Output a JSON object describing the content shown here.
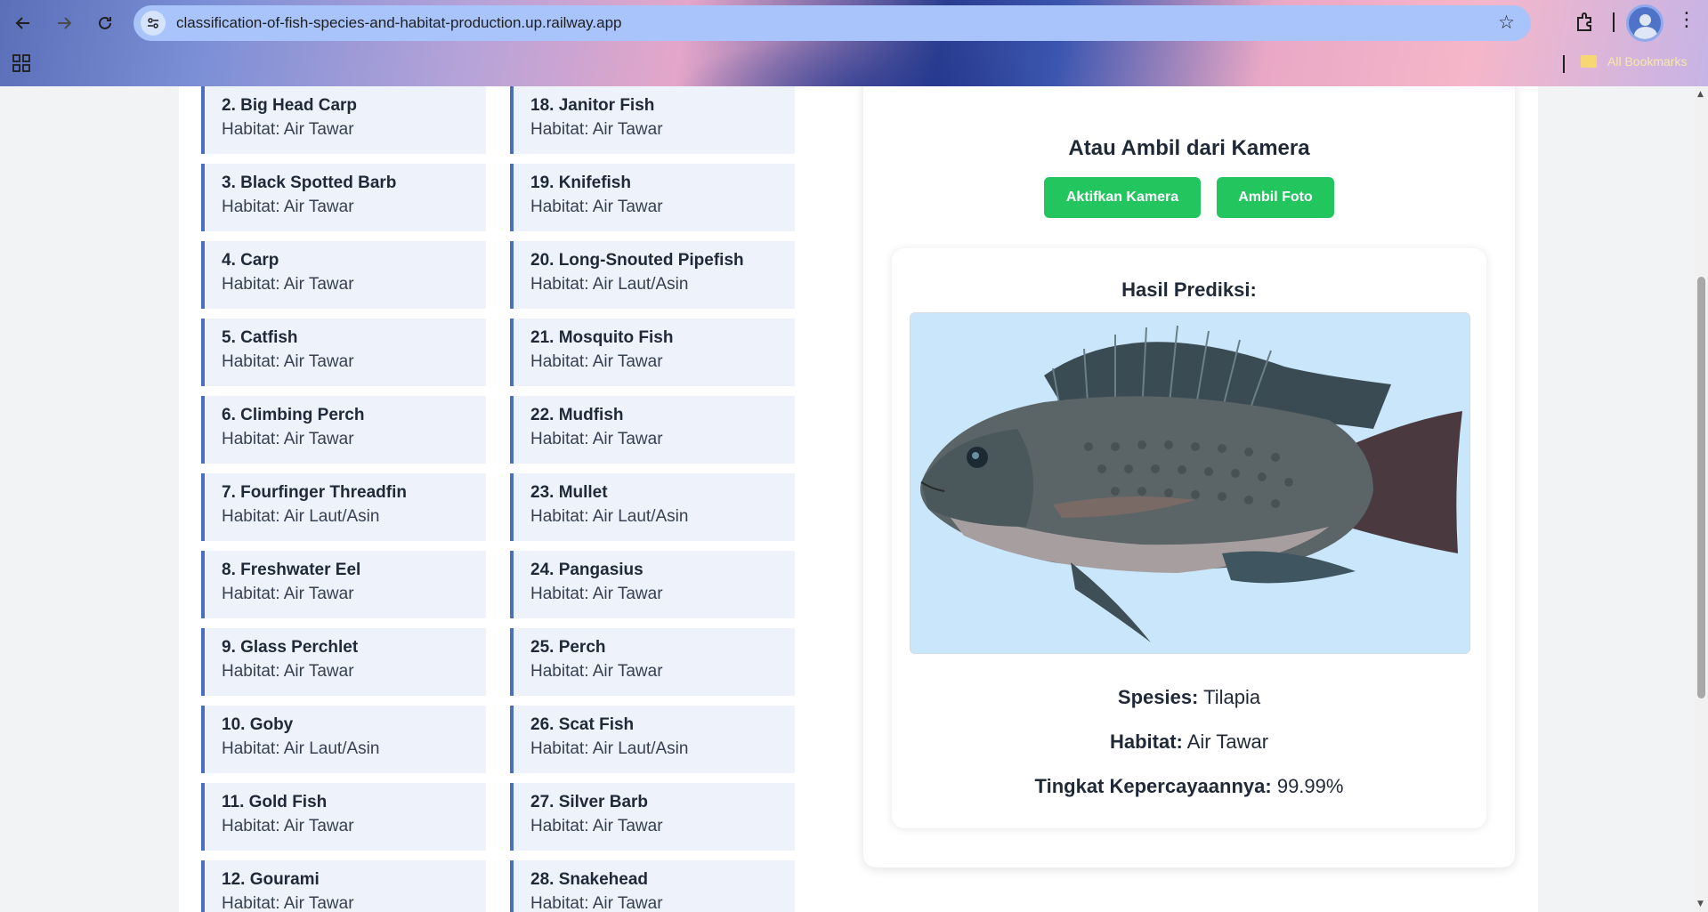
{
  "browser": {
    "url": "classification-of-fish-species-and-habitat-production.up.railway.app",
    "bookmarks_label": "All Bookmarks",
    "icons": [
      "back-icon",
      "forward-icon",
      "reload-icon",
      "site-info-icon",
      "star-icon",
      "extensions-icon",
      "profile-avatar",
      "menu-icon",
      "apps-icon",
      "folder-icon"
    ]
  },
  "fish_list": {
    "column1": [
      {
        "name": "2. Big Head Carp",
        "habitat": "Habitat: Air Tawar"
      },
      {
        "name": "3. Black Spotted Barb",
        "habitat": "Habitat: Air Tawar"
      },
      {
        "name": "4. Carp",
        "habitat": "Habitat: Air Tawar"
      },
      {
        "name": "5. Catfish",
        "habitat": "Habitat: Air Tawar"
      },
      {
        "name": "6. Climbing Perch",
        "habitat": "Habitat: Air Tawar"
      },
      {
        "name": "7. Fourfinger Threadfin",
        "habitat": "Habitat: Air Laut/Asin"
      },
      {
        "name": "8. Freshwater Eel",
        "habitat": "Habitat: Air Tawar"
      },
      {
        "name": "9. Glass Perchlet",
        "habitat": "Habitat: Air Tawar"
      },
      {
        "name": "10. Goby",
        "habitat": "Habitat: Air Laut/Asin"
      },
      {
        "name": "11. Gold Fish",
        "habitat": "Habitat: Air Tawar"
      },
      {
        "name": "12. Gourami",
        "habitat": "Habitat: Air Tawar"
      }
    ],
    "column2": [
      {
        "name": "18. Janitor Fish",
        "habitat": "Habitat: Air Tawar"
      },
      {
        "name": "19. Knifefish",
        "habitat": "Habitat: Air Tawar"
      },
      {
        "name": "20. Long-Snouted Pipefish",
        "habitat": "Habitat: Air Laut/Asin"
      },
      {
        "name": "21. Mosquito Fish",
        "habitat": "Habitat: Air Tawar"
      },
      {
        "name": "22. Mudfish",
        "habitat": "Habitat: Air Tawar"
      },
      {
        "name": "23. Mullet",
        "habitat": "Habitat: Air Laut/Asin"
      },
      {
        "name": "24. Pangasius",
        "habitat": "Habitat: Air Tawar"
      },
      {
        "name": "25. Perch",
        "habitat": "Habitat: Air Tawar"
      },
      {
        "name": "26. Scat Fish",
        "habitat": "Habitat: Air Laut/Asin"
      },
      {
        "name": "27. Silver Barb",
        "habitat": "Habitat: Air Tawar"
      },
      {
        "name": "28. Snakehead",
        "habitat": "Habitat: Air Tawar"
      }
    ]
  },
  "camera": {
    "title": "Atau Ambil dari Kamera",
    "activate_label": "Aktifkan Kamera",
    "capture_label": "Ambil Foto"
  },
  "result": {
    "title": "Hasil Prediksi:",
    "species_label": "Spesies:",
    "species_value": "Tilapia",
    "habitat_label": "Habitat:",
    "habitat_value": "Air Tawar",
    "confidence_label": "Tingkat Kepercayaannya:",
    "confidence_value": "99.99%"
  },
  "colors": {
    "button": "#22c55e",
    "list_accent": "#4a6ec0",
    "list_bg": "#edf2fb",
    "image_bg": "#c9e6fa"
  }
}
